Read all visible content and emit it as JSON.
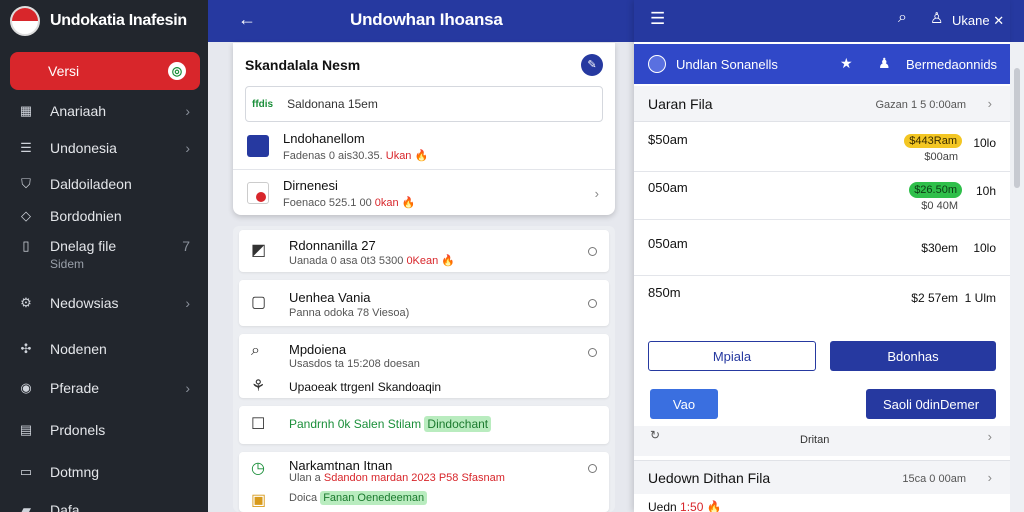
{
  "app": {
    "title": "Undokatia Inafesin"
  },
  "sidebar": {
    "active": {
      "label": "Versi",
      "badge": "◎"
    },
    "items": [
      {
        "label": "Anariaah",
        "icon": "grid-icon",
        "chevron": true
      },
      {
        "label": "Undonesia",
        "icon": "list-icon",
        "chevron": true
      },
      {
        "label": "Daldoiladeon",
        "icon": "shield-icon",
        "chevron": false
      },
      {
        "label": "Bordodnien",
        "icon": "tag-icon",
        "chevron": false
      },
      {
        "label": "Dnelag file",
        "sub": "Sidem",
        "icon": "phone-icon",
        "chevron": true,
        "chevron_label": "7"
      },
      {
        "label": "Nedowsias",
        "icon": "gear-icon",
        "chevron": true
      },
      {
        "label": "Nodenen",
        "icon": "puzzle-icon",
        "chevron": false
      },
      {
        "label": "Pferade",
        "icon": "globe-icon",
        "chevron": true
      },
      {
        "label": "Prdonels",
        "icon": "document-icon",
        "chevron": false
      },
      {
        "label": "Dotmng",
        "icon": "file-icon",
        "chevron": false
      },
      {
        "label": "Dafa",
        "icon": "folder-icon",
        "chevron": false
      }
    ]
  },
  "topbar": {
    "title": "Undowhan Ihoansa"
  },
  "search_card": {
    "title": "Skandalala Nesm",
    "search": {
      "tag": "ffdis",
      "value": "Saldonana 15em"
    },
    "rows": [
      {
        "title": "Lndohanellom",
        "detail": "Fadenas 0 ais30.35.",
        "detail_red": "Ukan",
        "flag": "🔥"
      },
      {
        "title": "Dirnenesi",
        "detail": "Foenaco 525.1 00",
        "detail_red": "0kan",
        "flag": "🔥"
      }
    ]
  },
  "list": [
    {
      "icon": "gauge-icon",
      "title": "Rdonnanilla 27",
      "detail": "Uanada 0 asa 0t3 5300",
      "detail_red": "0Kean",
      "flag": "🔥"
    },
    {
      "icon": "square-icon",
      "title": "Uenhea Vania",
      "detail": "Panna odoka 78 Viesoa)"
    },
    {
      "icon": "search-icon",
      "title": "Mpdoiena",
      "detail": "Usasdos ta 15:208 doesan",
      "extra": "Upaoeak ttrgenI Skandoaqin"
    },
    {
      "icon": "checkbox-icon",
      "title": "Pandrnh 0k Salen Stilam",
      "badge": "Dindochant"
    },
    {
      "icon": "clock-icon",
      "title": "Narkamtnan Itnan",
      "detail": "Ulan a",
      "detail_red": "Sdandon mardan 2023 P58 Sfasnam",
      "extra": "Doica",
      "extra_green": "Fanan Oenedeeman"
    }
  ],
  "right_panel": {
    "user_name": "Ukane ✕",
    "bar_label": "Undlan Sonanells",
    "bar_label2": "Bermedaonnids",
    "header": {
      "title": "Uaran Fila",
      "sub": "Gazan 1 5 0:00am"
    },
    "rows": [
      {
        "time": "$50am",
        "pill": "$443Ram",
        "pill_type": "yellow",
        "sub": "$00am",
        "dur": "10lo"
      },
      {
        "time": "050am",
        "pill": "$26.50m",
        "pill_type": "green",
        "sub": "$0 40M",
        "dur": "10h"
      },
      {
        "time": "050am",
        "price": "$30em",
        "dur": "10lo"
      },
      {
        "time": "850m",
        "price": "$2 57em",
        "dur": "1 Ulm"
      }
    ],
    "buttons": {
      "outline": "Mpiala",
      "fill": "Bdonhas",
      "small": "Vao",
      "large": "Saoli 0dinDemer"
    },
    "foot_label": "Dritan",
    "foot_header": {
      "title": "Uedown Dithan Fila",
      "sub": "15ca 0 00am"
    },
    "foot_row": {
      "text": "Uedn",
      "red": "1:50 🔥"
    }
  }
}
